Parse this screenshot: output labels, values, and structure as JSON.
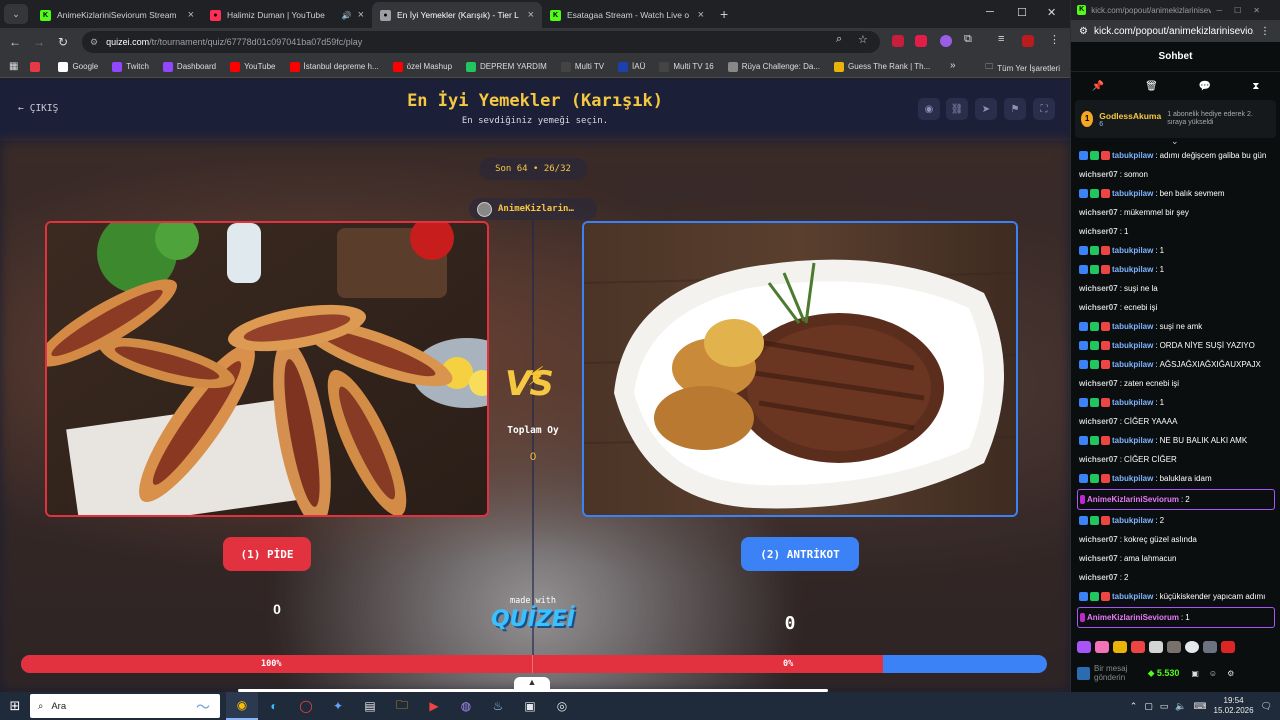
{
  "browser": {
    "tabs": [
      {
        "title": "AnimeKizlariniSeviorum Stream",
        "favicon_color": "#53fc18",
        "favicon": "K",
        "active": false,
        "has_audio": false
      },
      {
        "title": "Halimiz Duman | YouTube",
        "favicon_color": "#ff2e55",
        "favicon": "●",
        "active": false,
        "has_audio": true
      },
      {
        "title": "En İyi Yemekler (Karışık) - Tier L",
        "favicon_color": "#9aa0a6",
        "favicon": "●",
        "active": true,
        "has_audio": false
      },
      {
        "title": "Esatagaa Stream - Watch Live o",
        "favicon_color": "#53fc18",
        "favicon": "K",
        "active": false,
        "has_audio": false
      }
    ],
    "url_host": "quizei.com",
    "url_path": "/tr/tournament/quiz/67778d01c097041ba07d59fc/play",
    "bookmarks": [
      {
        "label": "",
        "color": "#e63946"
      },
      {
        "label": "Google",
        "color": "#ffffff"
      },
      {
        "label": "Twitch",
        "color": "#9146ff"
      },
      {
        "label": "Dashboard",
        "color": "#9146ff"
      },
      {
        "label": "YouTube",
        "color": "#ff0000"
      },
      {
        "label": "İstanbul depreme h...",
        "color": "#ff0000"
      },
      {
        "label": "özel Mashup",
        "color": "#ff0000"
      },
      {
        "label": "DEPREM YARDIM",
        "color": "#22c55e"
      },
      {
        "label": "Multi TV",
        "color": "#444444"
      },
      {
        "label": "İAÜ",
        "color": "#1e40af"
      },
      {
        "label": "Multi TV 16",
        "color": "#444444"
      },
      {
        "label": "Rüya Challenge: Da...",
        "color": "#888888"
      },
      {
        "label": "Guess The Rank | Th...",
        "color": "#eab308"
      }
    ],
    "bookmarks_all": "Tüm Yer İşaretleri"
  },
  "page": {
    "exit_label": "ÇIKIŞ",
    "title": "En İyi Yemekler (Karışık)",
    "subtitle": "En sevdiğiniz yemeği seçin.",
    "round_label": "Son 64 • 26/32",
    "creator": "AnimeKizlarin…",
    "vs_label": "VS",
    "total_votes_label": "Toplam Oy",
    "total_votes_value": "0",
    "left_option": {
      "label": "(1) PİDE",
      "votes": "0",
      "percent_label": "100%",
      "color": "#e2313f"
    },
    "right_option": {
      "label": "(2) ANTRİKOT",
      "votes": "0",
      "percent_label": "0%",
      "color": "#3b82f6"
    },
    "vote_share_left": 0.84,
    "made_with": "made with",
    "brand": "QUİZEİ"
  },
  "chat": {
    "window_url": "kick.com/popout/animekizlariniseviorum/chat",
    "addr_url": "kick.com/popout/animekizlariniseviо...",
    "header": "Sohbet",
    "gift": {
      "user": "GodlessAkuma",
      "count": "6",
      "text": "1 abonelik hediye ederek 2. sıraya yükseldi"
    },
    "messages": [
      {
        "user": "tabukpilaw",
        "text": "adımı değişcem galiba bu gün",
        "color": "#7fb3ff",
        "badges": true
      },
      {
        "user": "wichser07",
        "text": "somon",
        "color": "#cfcfcf",
        "badges": false
      },
      {
        "user": "tabukpilaw",
        "text": "ben balık sevmem",
        "color": "#7fb3ff",
        "badges": true
      },
      {
        "user": "wichser07",
        "text": "mükemmel bir şey",
        "color": "#cfcfcf",
        "badges": false
      },
      {
        "user": "wichser07",
        "text": "1",
        "color": "#cfcfcf",
        "badges": false
      },
      {
        "user": "tabukpilaw",
        "text": "1",
        "color": "#7fb3ff",
        "badges": true
      },
      {
        "user": "tabukpilaw",
        "text": "1",
        "color": "#7fb3ff",
        "badges": true
      },
      {
        "user": "wichser07",
        "text": "suşi ne la",
        "color": "#cfcfcf",
        "badges": false
      },
      {
        "user": "wichser07",
        "text": "ecnebi işi",
        "color": "#cfcfcf",
        "badges": false
      },
      {
        "user": "tabukpilaw",
        "text": "suşi ne amk",
        "color": "#7fb3ff",
        "badges": true
      },
      {
        "user": "tabukpilaw",
        "text": "ORDA NİYE SUŞİ YAZIYO",
        "color": "#7fb3ff",
        "badges": true
      },
      {
        "user": "tabukpilaw",
        "text": "AĞSJAĞXIAĞXIĞAUXPAJX",
        "color": "#7fb3ff",
        "badges": true
      },
      {
        "user": "wichser07",
        "text": "zaten ecnebi işi",
        "color": "#cfcfcf",
        "badges": false
      },
      {
        "user": "tabukpilaw",
        "text": "1",
        "color": "#7fb3ff",
        "badges": true
      },
      {
        "user": "wichser07",
        "text": "CİĞER YAAAA",
        "color": "#cfcfcf",
        "badges": false
      },
      {
        "user": "tabukpilaw",
        "text": "NE BU BALIK ALKI AMK",
        "color": "#7fb3ff",
        "badges": true
      },
      {
        "user": "wichser07",
        "text": "CİĞER CİĞER",
        "color": "#cfcfcf",
        "badges": false
      },
      {
        "user": "tabukpilaw",
        "text": "baluklara idam",
        "color": "#7fb3ff",
        "badges": true
      },
      {
        "user": "AnimeKizlariniSeviorum",
        "text": "2",
        "color": "#e879f9",
        "badges": false,
        "highlight": true
      },
      {
        "user": "tabukpilaw",
        "text": "2",
        "color": "#7fb3ff",
        "badges": true
      },
      {
        "user": "wichser07",
        "text": "kokreç güzel aslında",
        "color": "#cfcfcf",
        "badges": false
      },
      {
        "user": "wichser07",
        "text": "ama lahmacun",
        "color": "#cfcfcf",
        "badges": false
      },
      {
        "user": "wichser07",
        "text": "2",
        "color": "#cfcfcf",
        "badges": false
      },
      {
        "user": "tabukpilaw",
        "text": "küçükiskender yapıcam adımı",
        "color": "#7fb3ff",
        "badges": true
      },
      {
        "user": "AnimeKizlariniSeviorum",
        "text": "1",
        "color": "#e879f9",
        "badges": false,
        "highlight": true
      }
    ],
    "input_placeholder": "Bir mesaj gönderin",
    "points": "5.530"
  },
  "taskbar": {
    "search_placeholder": "Ara",
    "time": "19:54",
    "date": "15.02.2026"
  }
}
